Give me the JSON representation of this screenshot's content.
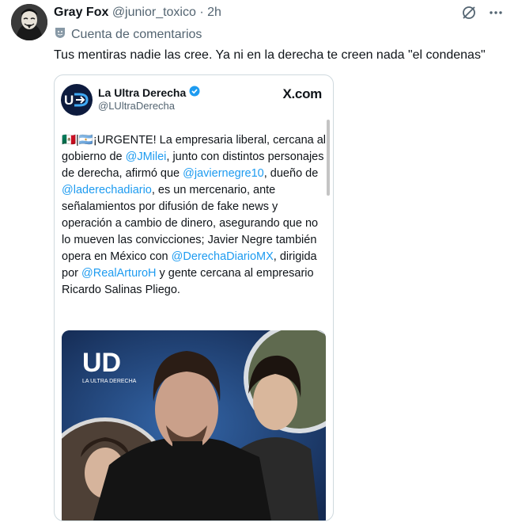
{
  "tweet": {
    "display_name": "Gray Fox",
    "handle": "@junior_toxico",
    "separator": " · ",
    "time": "2h",
    "account_type": "Cuenta de comentarios",
    "text": "Tus mentiras nadie las cree. Ya ni en la derecha te creen nada \"el condenas\""
  },
  "card": {
    "name": "La Ultra Derecha",
    "handle": "@LUltraDerecha",
    "site": "X.com",
    "body": {
      "flags": "🇲🇽|🇦🇷",
      "p1": "¡URGENTE! La empresaria liberal, cercana al gobierno de ",
      "m1": "@JMilei",
      "p2": ", junto con distintos personajes de derecha, afirmó que ",
      "m2": "@javiernegre10",
      "p3": ", dueño de ",
      "m3": "@laderechadiario",
      "p4": ", es un mercenario, ante señalamientos por difusión de fake news y operación a cambio de dinero, asegurando que no lo mueven las convicciones; Javier Negre también opera en México con ",
      "m4": "@DerechaDiarioMX",
      "p5": ", dirigida por ",
      "m5": "@RealArturoH",
      "p6": " y gente cercana al empresario Ricardo Salinas Pliego."
    },
    "image": {
      "logo_text": "UD",
      "logo_subtitle": "LA ULTRA DERECHA"
    }
  },
  "colors": {
    "link": "#1d9bf0",
    "secondary_text": "#536471",
    "verified": "#1d9bf0",
    "image_bg": "#1e3562"
  },
  "icons": [
    "grok-icon",
    "more-icon",
    "account-badge-icon",
    "verified-badge-icon"
  ]
}
